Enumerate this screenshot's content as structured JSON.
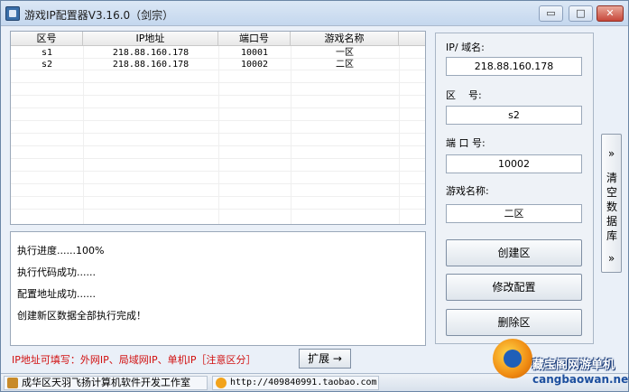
{
  "window": {
    "title": "游戏IP配置器V3.16.0（剑宗）",
    "controls": {
      "minimize": "▭",
      "maximize": "□",
      "close": "✕"
    }
  },
  "table": {
    "columns": [
      "区号",
      "IP地址",
      "端口号",
      "游戏名称"
    ],
    "rows": [
      [
        "s1",
        "218.88.160.178",
        "10001",
        "一区"
      ],
      [
        "s2",
        "218.88.160.178",
        "10002",
        "二区"
      ]
    ]
  },
  "log": {
    "lines": [
      "执行进度......100%",
      "执行代码成功......",
      "配置地址成功......",
      "创建新区数据全部执行完成！"
    ]
  },
  "form": {
    "ip_label": "IP/ 域名:",
    "ip_value": "218.88.160.178",
    "zone_label": "区    号:",
    "zone_value": "s2",
    "port_label": "端 口 号:",
    "port_value": "10002",
    "name_label": "游戏名称:",
    "name_value": "二区",
    "create_button": "创建区",
    "modify_button": "修改配置",
    "delete_button": "删除区"
  },
  "side_toggle": {
    "arrow_top": "»",
    "label": "清空数据库",
    "arrow_bottom": "»"
  },
  "hint": "IP地址可填写：外网IP、局域网IP、单机IP［注意区分］",
  "expand_button": "扩展 →",
  "statusbar": {
    "studio": "成华区天羽飞扬计算机软件开发工作室",
    "url": "http://409840991.taobao.com"
  },
  "watermark": {
    "cn": "藏宝阁网游单机",
    "en": "cangbaowan.net"
  }
}
